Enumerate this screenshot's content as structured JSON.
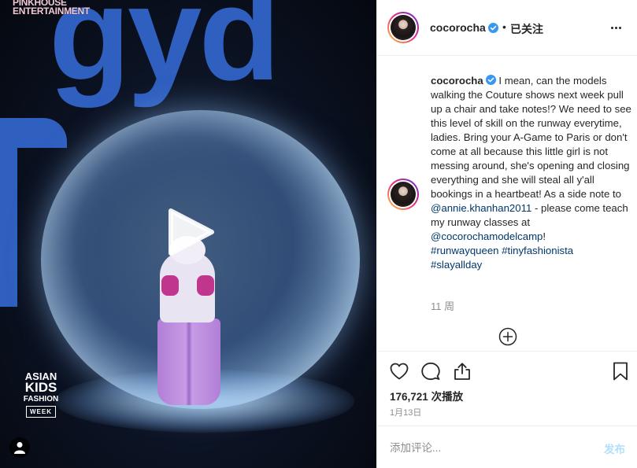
{
  "media": {
    "brand_line1": "PINKHOUSE",
    "brand_line2": "ENTERTAINMENT",
    "backdrop_letters": "gyd",
    "event_logo": [
      "ASIAN",
      "KIDS",
      "FASHION",
      "WEEK"
    ]
  },
  "header": {
    "username": "cocorocha",
    "separator": "•",
    "follow_status": "已关注"
  },
  "caption": {
    "username": "cocorocha",
    "text_1": "I mean, can the models walking the Couture shows next week pull up a chair and take notes!? We need to see this level of skill on the runway everytime, ladies. Bring your A-Game to Paris or don't come at all because this little girl is not messing around, she's opening and closing everything and she will steal all y'all bookings in a heartbeat! As a side note to ",
    "mention_1": "@annie.khanhan2011",
    "text_2": " - please come teach my runway classes at ",
    "mention_2": "@cocorochamodelcamp",
    "text_3": "!",
    "hashtag_1": "#runwayqueen",
    "hashtag_2": "#tinyfashionista",
    "hashtag_3": "#slayallday",
    "time_ago": "11 周"
  },
  "stats": {
    "views": "176,721",
    "views_label": "次播放",
    "date": "1月13日"
  },
  "comment_box": {
    "placeholder": "添加评论...",
    "post_label": "发布"
  },
  "colors": {
    "link": "#00376b",
    "verified": "#3897f0",
    "post_disabled": "#b2dffc",
    "muted": "#8e8e8e"
  }
}
